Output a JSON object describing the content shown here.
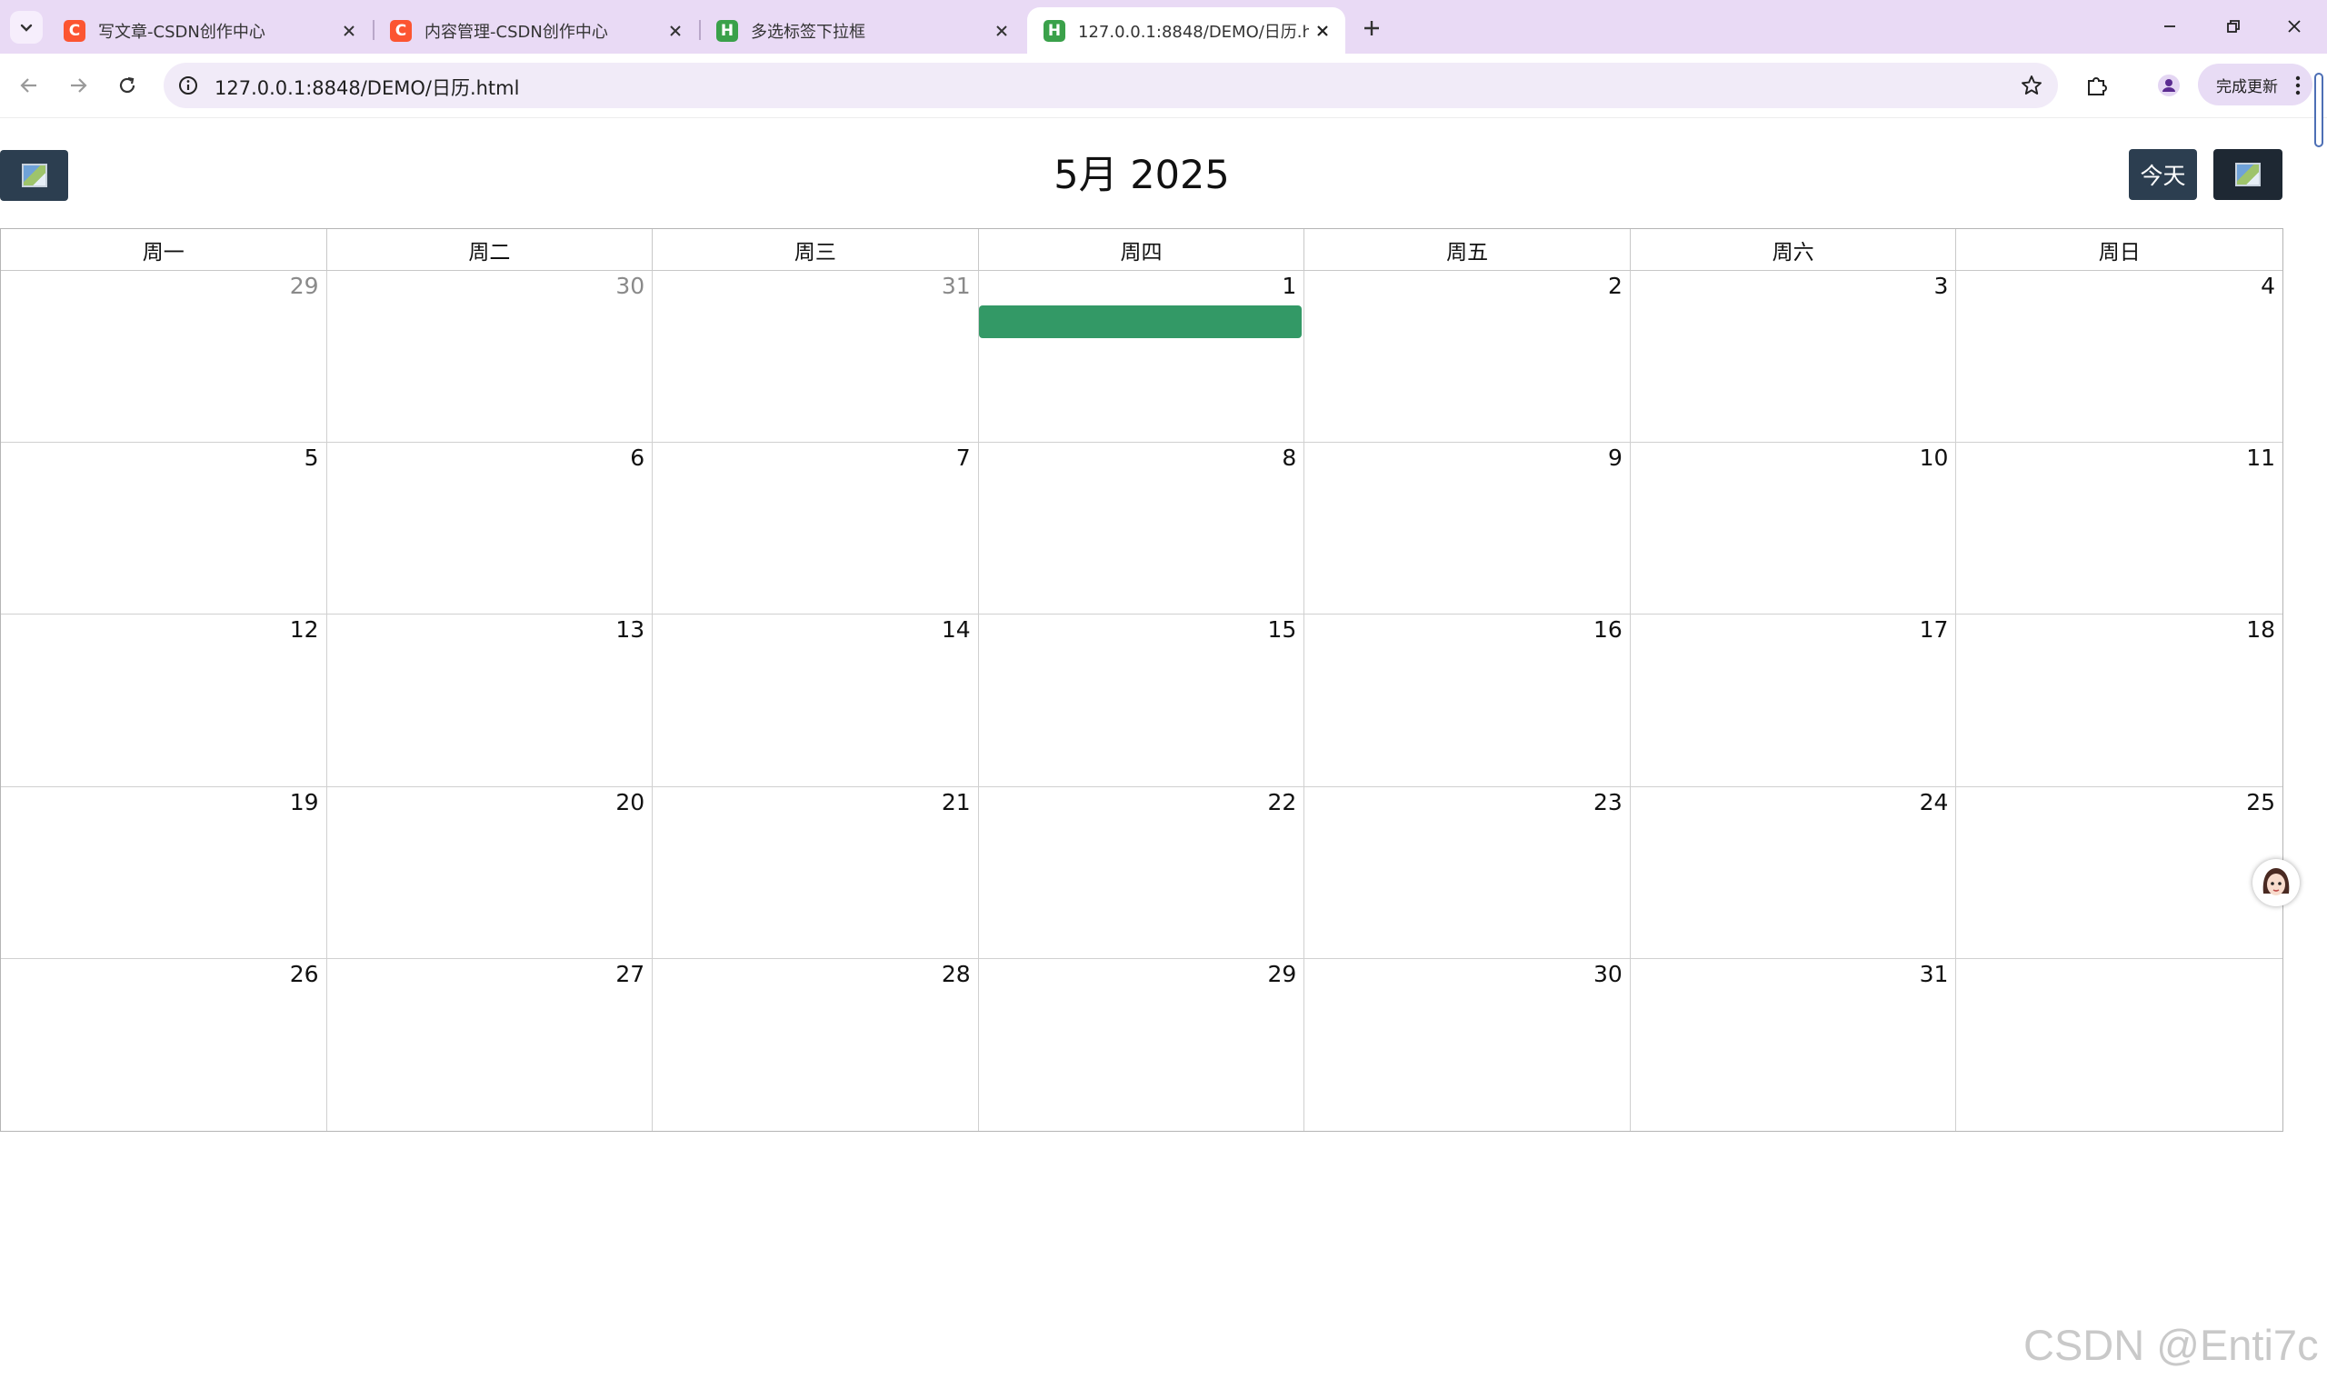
{
  "browser": {
    "tabs": [
      {
        "title": "写文章-CSDN创作中心",
        "favicon": "csdn-c-icon",
        "favicon_glyph": "C"
      },
      {
        "title": "内容管理-CSDN创作中心",
        "favicon": "csdn-c-icon",
        "favicon_glyph": "C"
      },
      {
        "title": "多选标签下拉框",
        "favicon": "hbuilder-h-icon",
        "favicon_glyph": "H"
      },
      {
        "title": "127.0.0.1:8848/DEMO/日历.html",
        "favicon": "hbuilder-h-icon",
        "favicon_glyph": "H"
      }
    ],
    "active_tab": 3,
    "url": "127.0.0.1:8848/DEMO/日历.html",
    "update_button_label": "完成更新"
  },
  "calendar": {
    "title": "5月 2025",
    "today_label": "今天",
    "weekdays": [
      "周一",
      "周二",
      "周三",
      "周四",
      "周五",
      "周六",
      "周日"
    ],
    "days": [
      {
        "label": "29",
        "other_month": true
      },
      {
        "label": "30",
        "other_month": true
      },
      {
        "label": "31",
        "other_month": true
      },
      {
        "label": "1",
        "other_month": false,
        "has_event": true
      },
      {
        "label": "2"
      },
      {
        "label": "3"
      },
      {
        "label": "4"
      },
      {
        "label": "5"
      },
      {
        "label": "6"
      },
      {
        "label": "7"
      },
      {
        "label": "8"
      },
      {
        "label": "9"
      },
      {
        "label": "10"
      },
      {
        "label": "11"
      },
      {
        "label": "12"
      },
      {
        "label": "13"
      },
      {
        "label": "14"
      },
      {
        "label": "15"
      },
      {
        "label": "16"
      },
      {
        "label": "17"
      },
      {
        "label": "18"
      },
      {
        "label": "19"
      },
      {
        "label": "20"
      },
      {
        "label": "21"
      },
      {
        "label": "22"
      },
      {
        "label": "23"
      },
      {
        "label": "24"
      },
      {
        "label": "25"
      },
      {
        "label": "26"
      },
      {
        "label": "27"
      },
      {
        "label": "28"
      },
      {
        "label": "29"
      },
      {
        "label": "30"
      },
      {
        "label": "31"
      },
      {
        "label": ""
      }
    ],
    "event_color": "#339966",
    "header_button_color": "#2c3e50"
  },
  "watermark": "CSDN @Enti7c"
}
